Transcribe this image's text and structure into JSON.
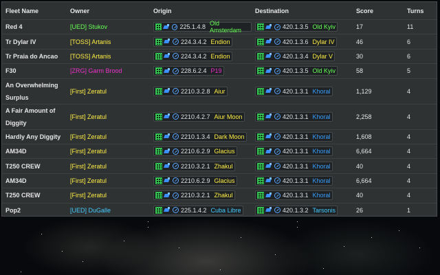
{
  "columns": {
    "fleet_name": "Fleet Name",
    "owner": "Owner",
    "origin": "Origin",
    "destination": "Destination",
    "score": "Score",
    "turns": "Turns"
  },
  "colors": {
    "UED": "#66ff55",
    "TOSS": "#ffee44",
    "ZRG": "#ee33cc",
    "First": "#ffee44",
    "UED_blue": "#44ccff",
    "planet_green": "#66ff55",
    "planet_yellow": "#ffee44",
    "planet_magenta": "#ee33cc",
    "planet_blue": "#3aa0ff",
    "planet_cyan": "#44ccff"
  },
  "fleets": [
    {
      "name": "Red 4",
      "tag": "[UED]",
      "player": "Stukov",
      "owner_color": "#66ff55",
      "origin_coord": "225.1.4.8",
      "origin_planet": "Old Amsterdam",
      "origin_color": "#66ff55",
      "dest_coord": "420.1.3.5",
      "dest_planet": "Old Kyiv",
      "dest_color": "#66ff55",
      "score": "17",
      "turns": "11"
    },
    {
      "name": "Tr Dylar IV",
      "tag": "[TOSS]",
      "player": "Artanis",
      "owner_color": "#ffee44",
      "origin_coord": "224.3.4.2",
      "origin_planet": "Endion",
      "origin_color": "#ffee44",
      "dest_coord": "420.1.3.6",
      "dest_planet": "Dylar IV",
      "dest_color": "#ffee44",
      "score": "46",
      "turns": "6"
    },
    {
      "name": "Tr Praia do Ancao",
      "tag": "[TOSS]",
      "player": "Artanis",
      "owner_color": "#ffee44",
      "origin_coord": "224.3.4.2",
      "origin_planet": "Endion",
      "origin_color": "#ffee44",
      "dest_coord": "420.1.3.4",
      "dest_planet": "Dylar V",
      "dest_color": "#ffee44",
      "score": "30",
      "turns": "6"
    },
    {
      "name": "F30",
      "tag": "[ZRG]",
      "player": "Garm Brood",
      "owner_color": "#ee33cc",
      "origin_coord": "228.6.2.4",
      "origin_planet": "P19",
      "origin_color": "#ee33cc",
      "dest_coord": "420.1.3.5",
      "dest_planet": "Old Kyiv",
      "dest_color": "#66ff55",
      "score": "58",
      "turns": "5"
    },
    {
      "name": "An Overwhelming Surplus",
      "tag": "[First]",
      "player": "Zeratul",
      "owner_color": "#ffee44",
      "origin_coord": "2210.3.2.8",
      "origin_planet": "Aiur",
      "origin_color": "#ffee44",
      "dest_coord": "420.1.3.1",
      "dest_planet": "Khoral",
      "dest_color": "#3aa0ff",
      "score": "1,129",
      "turns": "4",
      "tall": true
    },
    {
      "name": "A Fair Amount of Diggity",
      "tag": "[First]",
      "player": "Zeratul",
      "owner_color": "#ffee44",
      "origin_coord": "2210.4.2.7",
      "origin_planet": "Aiur Moon",
      "origin_color": "#ffee44",
      "dest_coord": "420.1.3.1",
      "dest_planet": "Khoral",
      "dest_color": "#3aa0ff",
      "score": "2,258",
      "turns": "4",
      "tall": true
    },
    {
      "name": "Hardly Any Diggity",
      "tag": "[First]",
      "player": "Zeratul",
      "owner_color": "#ffee44",
      "origin_coord": "2210.1.3.4",
      "origin_planet": "Dark Moon",
      "origin_color": "#ffee44",
      "dest_coord": "420.1.3.1",
      "dest_planet": "Khoral",
      "dest_color": "#3aa0ff",
      "score": "1,608",
      "turns": "4"
    },
    {
      "name": "AM34D",
      "tag": "[First]",
      "player": "Zeratul",
      "owner_color": "#ffee44",
      "origin_coord": "2210.6.2.9",
      "origin_planet": "Glacius",
      "origin_color": "#ffee44",
      "dest_coord": "420.1.3.1",
      "dest_planet": "Khoral",
      "dest_color": "#3aa0ff",
      "score": "6,664",
      "turns": "4"
    },
    {
      "name": "T250 CREW",
      "tag": "[First]",
      "player": "Zeratul",
      "owner_color": "#ffee44",
      "origin_coord": "2210.3.2.1",
      "origin_planet": "Zhakul",
      "origin_color": "#ffee44",
      "dest_coord": "420.1.3.1",
      "dest_planet": "Khoral",
      "dest_color": "#3aa0ff",
      "score": "40",
      "turns": "4"
    },
    {
      "name": "AM34D",
      "tag": "[First]",
      "player": "Zeratul",
      "owner_color": "#ffee44",
      "origin_coord": "2210.6.2.9",
      "origin_planet": "Glacius",
      "origin_color": "#ffee44",
      "dest_coord": "420.1.3.1",
      "dest_planet": "Khoral",
      "dest_color": "#3aa0ff",
      "score": "6,664",
      "turns": "4"
    },
    {
      "name": "T250 CREW",
      "tag": "[First]",
      "player": "Zeratul",
      "owner_color": "#ffee44",
      "origin_coord": "2210.3.2.1",
      "origin_planet": "Zhakul",
      "origin_color": "#ffee44",
      "dest_coord": "420.1.3.1",
      "dest_planet": "Khoral",
      "dest_color": "#3aa0ff",
      "score": "40",
      "turns": "4"
    },
    {
      "name": "Pop2",
      "tag": "[UED]",
      "player": "DuGalle",
      "owner_color": "#44ccff",
      "origin_coord": "225.1.4.2",
      "origin_planet": "Cuba Libre",
      "origin_color": "#44ccff",
      "dest_coord": "420.1.3.2",
      "dest_planet": "Tarsonis",
      "dest_color": "#44ccff",
      "score": "26",
      "turns": "1"
    }
  ],
  "icons": {
    "grid": "system-map-icon",
    "ship": "fleet-icon",
    "target": "target-icon"
  }
}
